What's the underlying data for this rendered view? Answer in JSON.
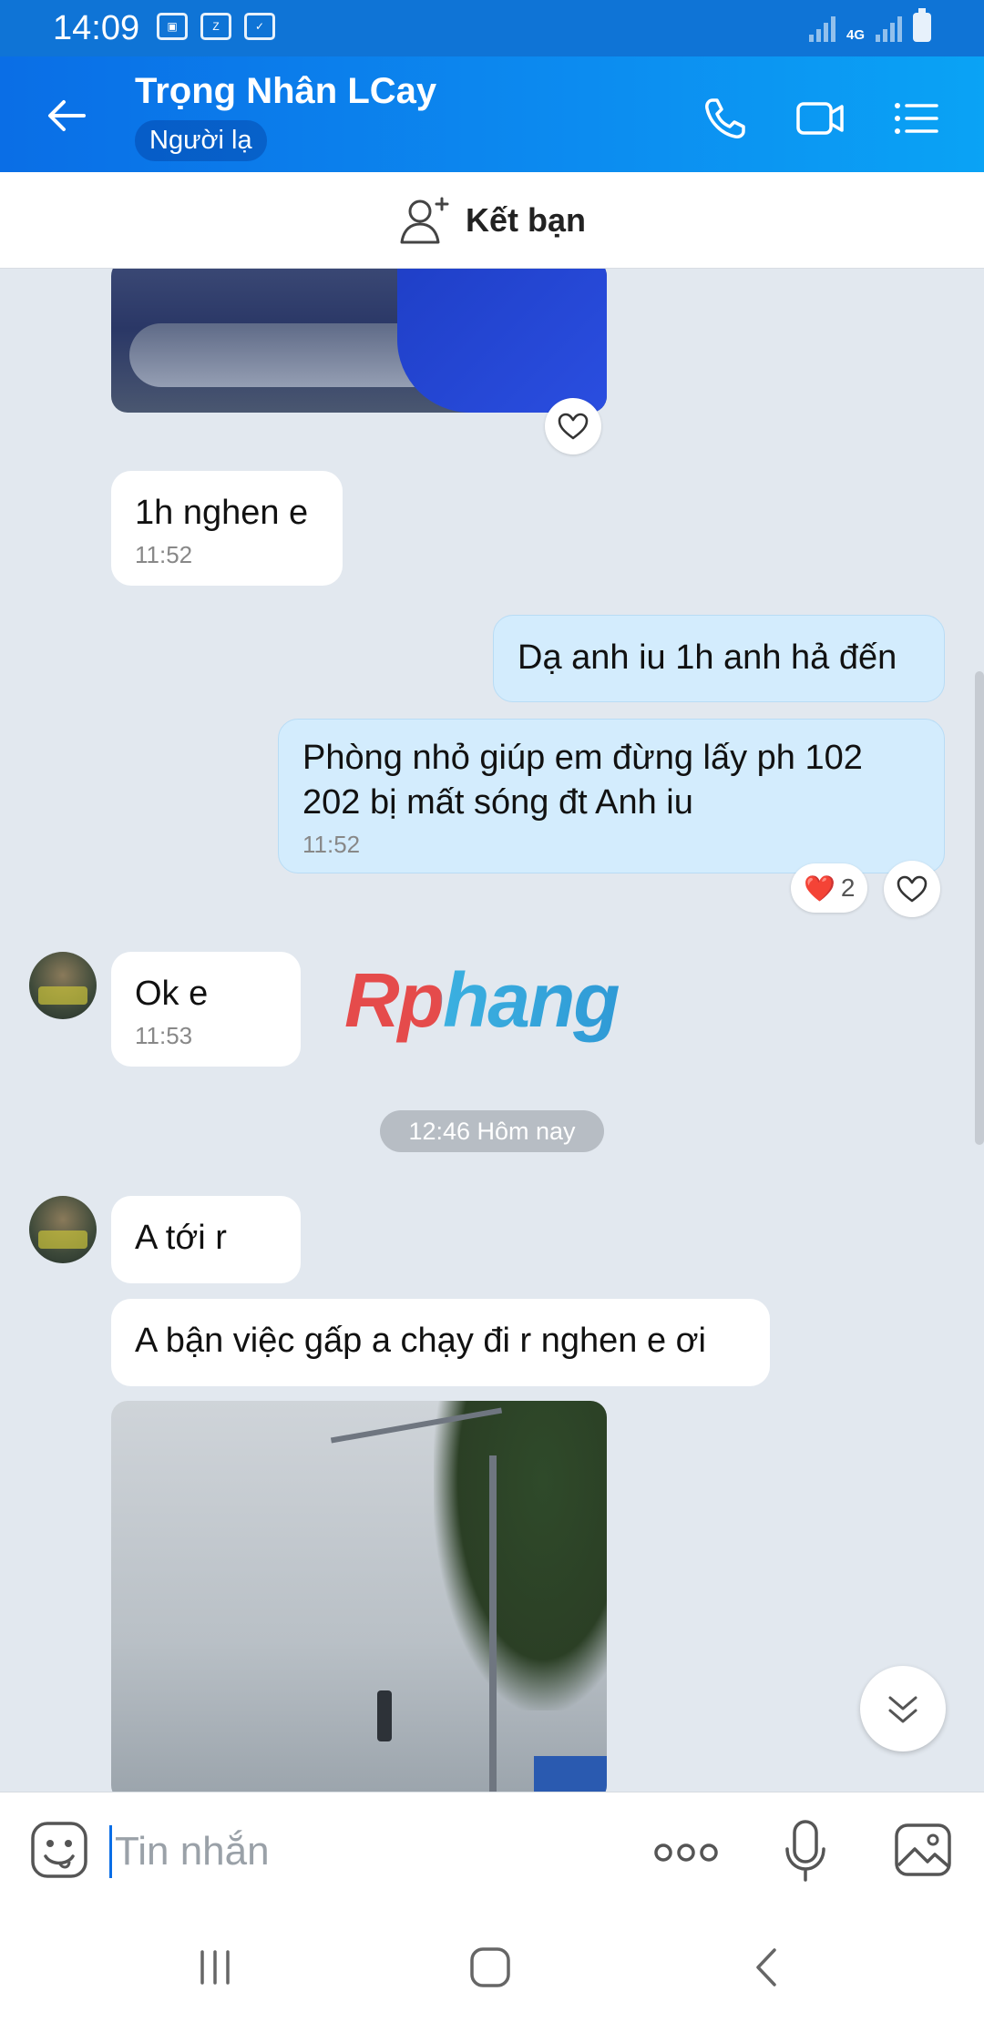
{
  "status_bar": {
    "time": "14:09",
    "network": "4G",
    "notification_icons": [
      "image-icon",
      "zalo-icon",
      "message-icon"
    ]
  },
  "header": {
    "contact_name": "Trọng Nhân LCay",
    "contact_badge": "Người lạ",
    "icons": [
      "back-arrow-icon",
      "phone-icon",
      "video-call-icon",
      "menu-list-icon"
    ],
    "accent_color": "#0a6ee6"
  },
  "friend_bar": {
    "label": "Kết bạn"
  },
  "messages": [
    {
      "id": "m1",
      "side": "in",
      "text": "1h nghen e",
      "time": "11:52"
    },
    {
      "id": "m2",
      "side": "out",
      "text": "Dạ anh iu 1h anh hả đến"
    },
    {
      "id": "m3",
      "side": "out",
      "text": "Phòng nhỏ giúp em đừng lấy ph 102 202 bị mất sóng đt Anh iu",
      "time": "11:52",
      "reaction": "❤️",
      "reaction_count": "2"
    },
    {
      "id": "m4",
      "side": "in",
      "text": "Ok e",
      "time": "11:53"
    },
    {
      "id": "m5",
      "side": "in",
      "text": "A tới r"
    },
    {
      "id": "m6",
      "side": "in",
      "text": "A bận việc gấp a chạy đi r nghen e ơi"
    }
  ],
  "date_separator": "12:46 Hôm nay",
  "watermark": "Rphang",
  "input": {
    "placeholder": "Tin nhắn",
    "value": ""
  }
}
